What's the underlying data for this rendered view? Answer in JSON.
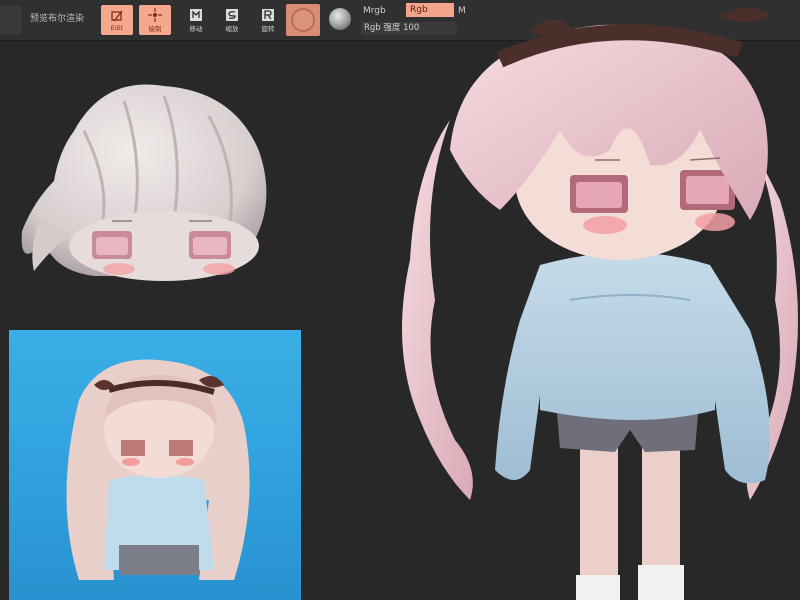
{
  "toolbar": {
    "preview_label": "预览布尔渲染",
    "tools": [
      {
        "label": "Edit",
        "icon": "edit-icon",
        "active": true
      },
      {
        "label": "绘制",
        "icon": "draw-icon",
        "active": true
      },
      {
        "label": "移动",
        "icon": "move-icon",
        "active": false
      },
      {
        "label": "缩放",
        "icon": "scale-icon",
        "active": false
      },
      {
        "label": "旋转",
        "icon": "rotate-icon",
        "active": false
      }
    ],
    "mrgb_label": "Mrgb",
    "rgb_label": "Rgb",
    "m_label": "M",
    "rgb_intensity": "Rgb 强度 100"
  },
  "colors": {
    "background": "#282828",
    "toolbar": "#303030",
    "accent": "#f4a98e",
    "reference_bg": "#2f9fdc",
    "hair": "#f0d0d6",
    "clay": "#e4dcdb",
    "sweater": "#b8d2e3",
    "shorts": "#6e6e78"
  }
}
